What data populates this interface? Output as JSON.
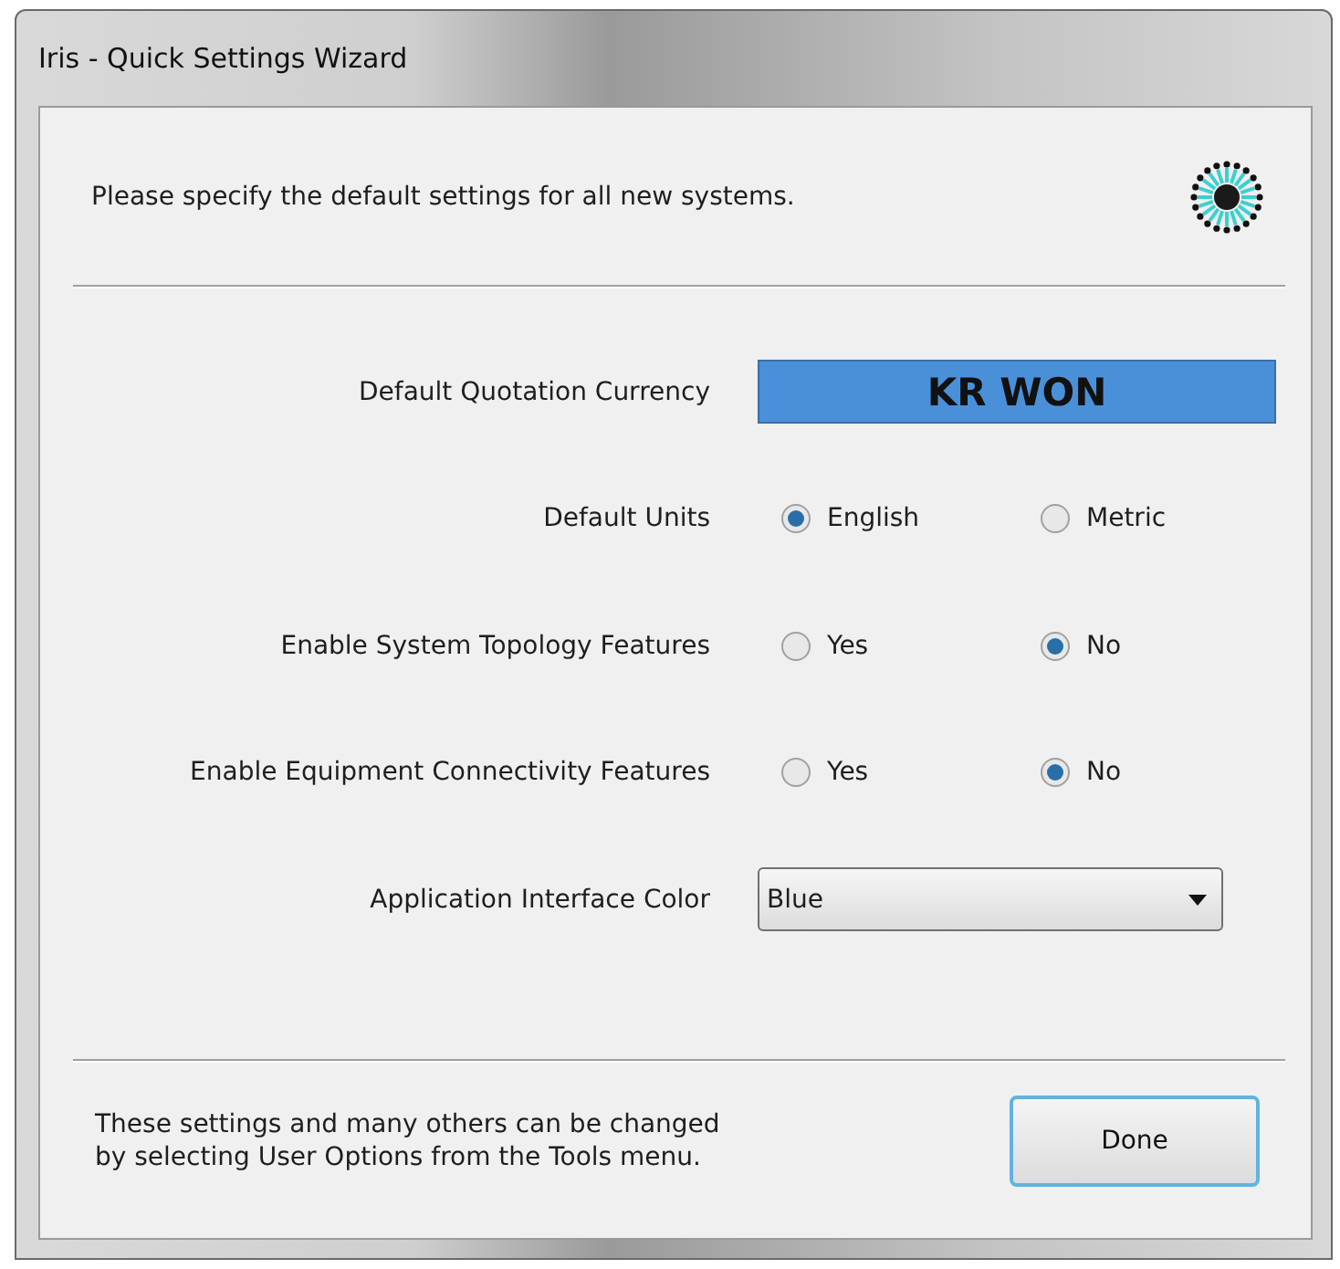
{
  "window": {
    "title": "Iris - Quick Settings Wizard"
  },
  "header": {
    "text": "Please specify the default settings for all new systems."
  },
  "settings": [
    {
      "kind": "currency",
      "label": "Default Quotation Currency",
      "value": "KR WON"
    },
    {
      "kind": "radio",
      "label": "Default Units",
      "options": [
        {
          "label": "English",
          "selected": true
        },
        {
          "label": "Metric",
          "selected": false
        }
      ]
    },
    {
      "kind": "radio",
      "label": "Enable System Topology Features",
      "options": [
        {
          "label": "Yes",
          "selected": false
        },
        {
          "label": "No",
          "selected": true
        }
      ]
    },
    {
      "kind": "radio",
      "label": "Enable Equipment Connectivity Features",
      "options": [
        {
          "label": "Yes",
          "selected": false
        },
        {
          "label": "No",
          "selected": true
        }
      ]
    },
    {
      "kind": "dropdown",
      "label": "Application Interface Color",
      "value": "Blue"
    }
  ],
  "footer": {
    "note": "These settings and many others can be changed\nby selecting User Options from the Tools menu.",
    "button": "Done"
  }
}
